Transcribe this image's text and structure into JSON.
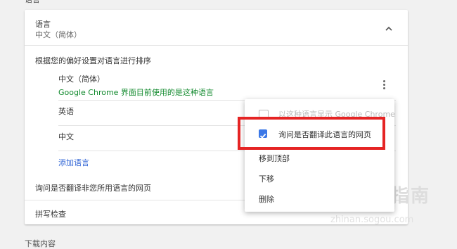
{
  "top_section_label": "语言",
  "card": {
    "language_title": "语言",
    "language_value": "中文（简体）",
    "order_hint": "根据您的偏好设置对语言进行排序",
    "languages": [
      {
        "name": "中文（简体）",
        "note": "Google Chrome 界面目前使用的是这种语言"
      },
      {
        "name": "英语"
      },
      {
        "name": "中文"
      }
    ],
    "add_language": "添加语言",
    "translate_prompt": "询问是否翻译非您所用语言的网页",
    "spell_check": "拼写检查"
  },
  "menu": {
    "items": [
      {
        "label": "以这种语言显示 Google Chrome",
        "checked": false,
        "disabled": true
      },
      {
        "label": "询问是否翻译此语言的网页",
        "checked": true
      },
      {
        "label": "移到顶部"
      },
      {
        "label": "下移"
      },
      {
        "label": "删除"
      }
    ]
  },
  "bottom_section_label": "下载内容",
  "watermark": {
    "brand": "搜狗指南",
    "url": "zhinan.sogou.com"
  },
  "colors": {
    "accent": "#3b78e7",
    "link": "#3367d6",
    "green_note": "#128a2e",
    "highlight": "#e52424"
  }
}
